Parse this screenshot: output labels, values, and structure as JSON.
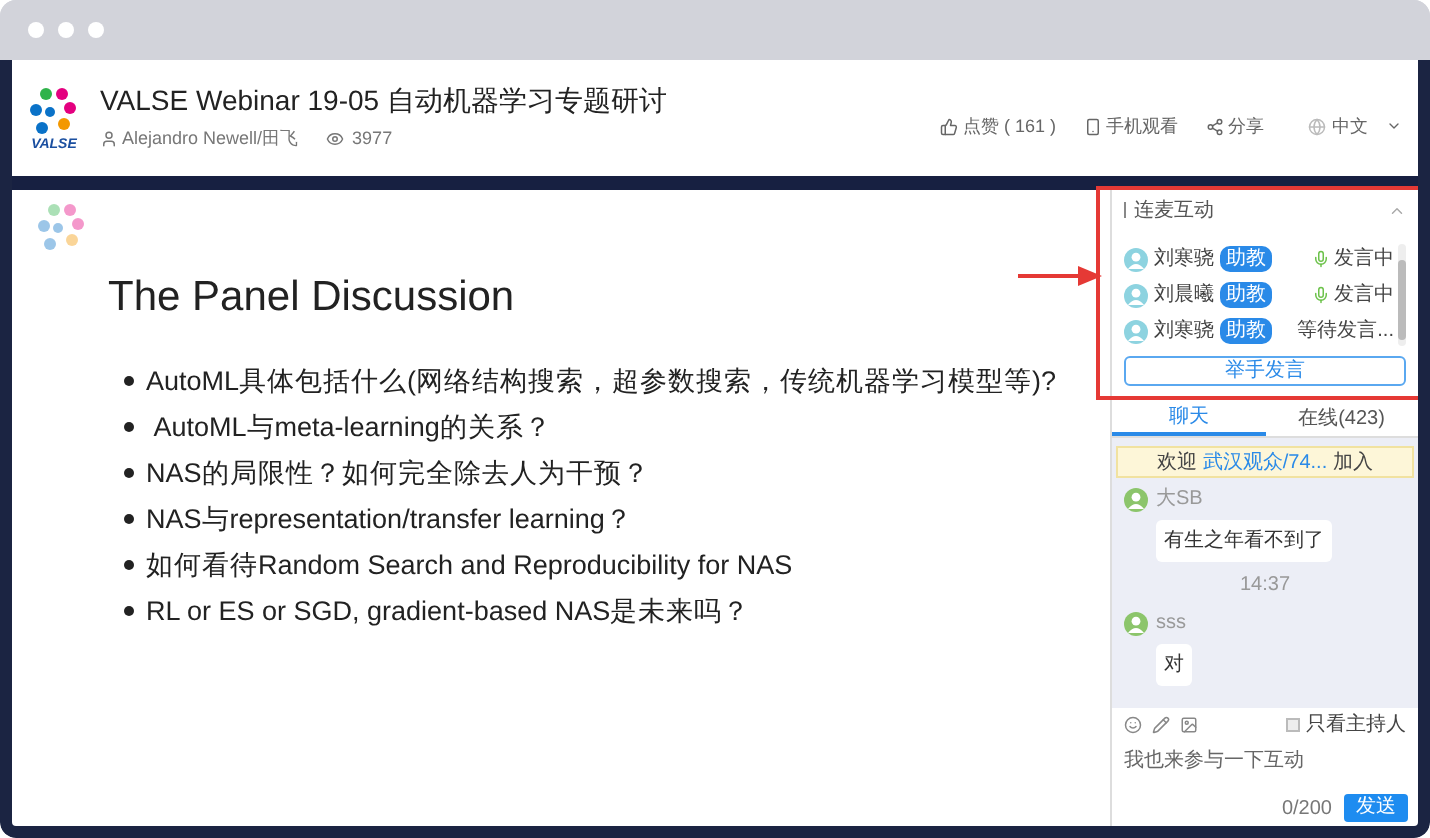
{
  "header": {
    "logo_text": "VALSE",
    "title": "VALSE Webinar 19-05 自动机器学习专题研讨",
    "presenter": "Alejandro Newell/田飞",
    "views": "3977",
    "actions": [
      {
        "kind": "like",
        "label": "点赞 ( 161 )"
      },
      {
        "kind": "mobile",
        "label": "手机观看"
      },
      {
        "kind": "share",
        "label": "分享"
      }
    ],
    "language": "中文"
  },
  "slide": {
    "title": "The Panel Discussion",
    "bullets": [
      "AutoML具体包括什么(网络结构搜索，超参数搜索，传统机器学习模型等)?",
      " AutoML与meta-learning的关系？",
      "NAS的局限性？如何完全除去人为干预？",
      "NAS与representation/transfer learning？",
      "如何看待Random Search and Reproducibility for NAS",
      "RL or ES or SGD, gradient-based NAS是未来吗？"
    ]
  },
  "panel": {
    "title": "连麦互动",
    "participants": [
      {
        "name": "刘寒骁",
        "role": "助教",
        "status": "发言中",
        "speaking": true
      },
      {
        "name": "刘晨曦",
        "role": "助教",
        "status": "发言中",
        "speaking": true
      },
      {
        "name": "刘寒骁",
        "role": "助教",
        "status": "等待发言...",
        "speaking": false
      }
    ],
    "raise_hand": "举手发言",
    "tabs": [
      {
        "label": "聊天",
        "selected": true
      },
      {
        "label": "在线(423)",
        "selected": false
      }
    ],
    "welcome": {
      "prefix": "欢迎",
      "user": "武汉观众/74...",
      "suffix": "加入"
    },
    "messages": [
      {
        "kind": "message",
        "user": "大SB",
        "text": "有生之年看不到了"
      },
      {
        "kind": "time",
        "text": "14:37"
      },
      {
        "kind": "message",
        "user": "sss",
        "text": "对"
      }
    ],
    "host_only": {
      "label": "只看主持人",
      "checked": false
    },
    "input": {
      "placeholder": "我也来参与一下互动"
    },
    "counter": "0/200",
    "send": "发送"
  }
}
